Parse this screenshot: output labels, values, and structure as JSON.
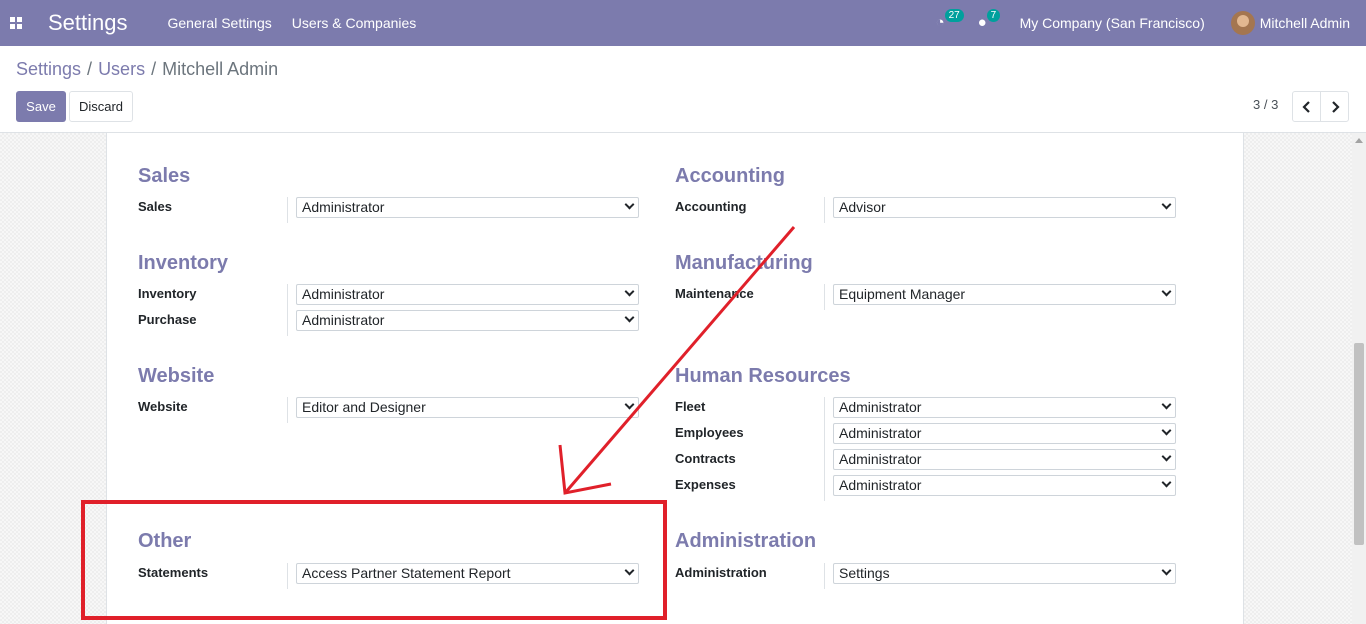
{
  "navbar": {
    "app_title": "Settings",
    "menu": [
      "General Settings",
      "Users & Companies"
    ],
    "activity_count": "27",
    "message_count": "7",
    "company": "My Company (San Francisco)",
    "user": "Mitchell Admin"
  },
  "breadcrumb": {
    "items": [
      "Settings",
      "Users",
      "Mitchell Admin"
    ],
    "separator": "/"
  },
  "buttons": {
    "save": "Save",
    "discard": "Discard"
  },
  "pager": {
    "value": "3 / 3"
  },
  "groups": {
    "sales": {
      "title": "Sales",
      "fields": [
        {
          "label": "Sales",
          "value": "Administrator"
        }
      ]
    },
    "accounting": {
      "title": "Accounting",
      "fields": [
        {
          "label": "Accounting",
          "value": "Advisor"
        }
      ]
    },
    "inventory": {
      "title": "Inventory",
      "fields": [
        {
          "label": "Inventory",
          "value": "Administrator"
        },
        {
          "label": "Purchase",
          "value": "Administrator"
        }
      ]
    },
    "manufacturing": {
      "title": "Manufacturing",
      "fields": [
        {
          "label": "Maintenance",
          "value": "Equipment Manager"
        }
      ]
    },
    "website": {
      "title": "Website",
      "fields": [
        {
          "label": "Website",
          "value": "Editor and Designer"
        }
      ]
    },
    "human_resources": {
      "title": "Human Resources",
      "fields": [
        {
          "label": "Fleet",
          "value": "Administrator"
        },
        {
          "label": "Employees",
          "value": "Administrator"
        },
        {
          "label": "Contracts",
          "value": "Administrator"
        },
        {
          "label": "Expenses",
          "value": "Administrator"
        }
      ]
    },
    "other": {
      "title": "Other",
      "fields": [
        {
          "label": "Statements",
          "value": "Access Partner Statement Report"
        }
      ]
    },
    "administration": {
      "title": "Administration",
      "fields": [
        {
          "label": "Administration",
          "value": "Settings"
        }
      ]
    }
  },
  "colors": {
    "brand": "#7c7bad",
    "annotation": "#e0202a",
    "badge": "#00a09d"
  },
  "icons": [
    "apps-icon",
    "activity-icon",
    "chat-icon",
    "chevron-left-icon",
    "chevron-right-icon",
    "chevron-down-icon"
  ]
}
